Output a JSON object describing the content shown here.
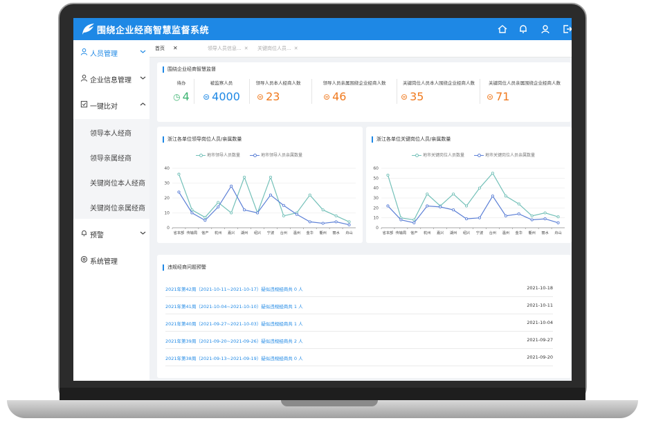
{
  "app": {
    "title": "围绕企业经商智慧监督系统",
    "top_icons": [
      "home-icon",
      "bell-icon",
      "user-icon",
      "logout-icon"
    ],
    "accent_color": "#1e88e5"
  },
  "sidebar": {
    "items": [
      {
        "label": "人员管理",
        "icon": "person-icon",
        "active": true
      },
      {
        "label": "企业信息管理",
        "icon": "person-icon"
      },
      {
        "label": "一键比对",
        "icon": "compare-icon",
        "expanded": true
      },
      {
        "label": "预警",
        "icon": "bell-icon"
      },
      {
        "label": "系统管理",
        "icon": "settings-icon"
      }
    ],
    "subitems": [
      "领导本人经商",
      "领导亲属经商",
      "关键岗位本人经商",
      "关键岗位亲属经商"
    ]
  },
  "tabs": [
    {
      "label": "首页",
      "active": true
    },
    {
      "label": "领导人员信息..."
    },
    {
      "label": "关键岗位人员..."
    }
  ],
  "summary": {
    "title": "围绕企业经商智慧监督",
    "stats": [
      {
        "label": "待办",
        "value": "4",
        "icon": "clock-icon",
        "color": "#3cb371"
      },
      {
        "label": "被监察人员",
        "value": "4000",
        "icon": "user-circle-icon",
        "color": "#1e88e5"
      },
      {
        "label": "领导人员本人经商人数",
        "value": "23",
        "icon": "user-circle-icon",
        "color": "#f07a1f"
      },
      {
        "label": "领导人员亲属围绕企业经商人数",
        "value": "46",
        "icon": "user-circle-icon",
        "color": "#f07a1f"
      },
      {
        "label": "关键岗位人员本人围绕企业经商人数",
        "value": "35",
        "icon": "user-circle-icon",
        "color": "#f07a1f"
      },
      {
        "label": "关键岗位人员亲属围绕企业经商人数",
        "value": "71",
        "icon": "user-circle-icon",
        "color": "#f07a1f"
      }
    ]
  },
  "chart_data": [
    {
      "type": "line",
      "title": "浙江各单位领导岗位人员/亲属数量",
      "categories": [
        "省本部",
        "传输局",
        "信产",
        "杭州",
        "嘉兴",
        "湖州",
        "绍兴",
        "宁波",
        "台州",
        "温州",
        "金华",
        "衢州",
        "丽水",
        "舟山"
      ],
      "ylim": [
        0,
        40
      ],
      "yticks": [
        0,
        10,
        20,
        30,
        40
      ],
      "grid": true,
      "legend": "top-center",
      "series": [
        {
          "name": "地市领导人员数量",
          "color": "#73c0b8",
          "values": [
            36,
            12,
            7,
            17,
            10,
            34,
            10,
            34,
            8,
            10,
            22,
            12,
            8,
            4
          ]
        },
        {
          "name": "地市领导人员亲属数量",
          "color": "#5b7fd6",
          "values": [
            24,
            10,
            5,
            14,
            28,
            12,
            10,
            22,
            15,
            9,
            4,
            3,
            4,
            2
          ]
        }
      ]
    },
    {
      "type": "line",
      "title": "浙江各单位关键岗位人员/亲属数量",
      "categories": [
        "省本部",
        "传输局",
        "信产",
        "杭州",
        "嘉兴",
        "湖州",
        "绍兴",
        "宁波",
        "台州",
        "温州",
        "金华",
        "衢州",
        "丽水",
        "舟山"
      ],
      "ylim": [
        0,
        60
      ],
      "yticks": [
        0,
        10,
        20,
        30,
        40,
        50,
        60
      ],
      "grid": true,
      "legend": "top-center",
      "series": [
        {
          "name": "地市关键岗位人员数量",
          "color": "#73c0b8",
          "values": [
            53,
            10,
            8,
            34,
            22,
            34,
            22,
            40,
            55,
            32,
            24,
            12,
            15,
            11
          ]
        },
        {
          "name": "地市关键岗位人员亲属数量",
          "color": "#5b7fd6",
          "values": [
            22,
            8,
            5,
            22,
            21,
            18,
            9,
            10,
            32,
            12,
            14,
            8,
            9,
            5
          ]
        }
      ]
    }
  ],
  "alerts": {
    "title": "违规经商问题预警",
    "rows": [
      {
        "text": "2021年第42周（2021-10-11~2021-10-17）疑似违规经商共 0 人",
        "date": "2021-10-18"
      },
      {
        "text": "2021年第41周（2021-10-04~2021-10-10）疑似违规经商共 1 人",
        "date": "2021-10-11"
      },
      {
        "text": "2021年第40周（2021-09-27~2021-10-03）疑似违规经商共 1 人",
        "date": "2021-10-04"
      },
      {
        "text": "2021年第39周（2021-09-20~2021-09-26）疑似违规经商共 2 人",
        "date": "2021-09-27"
      },
      {
        "text": "2021年第38周（2021-09-13~2021-09-19）疑似违规经商共 0 人",
        "date": "2021-09-20"
      }
    ]
  }
}
